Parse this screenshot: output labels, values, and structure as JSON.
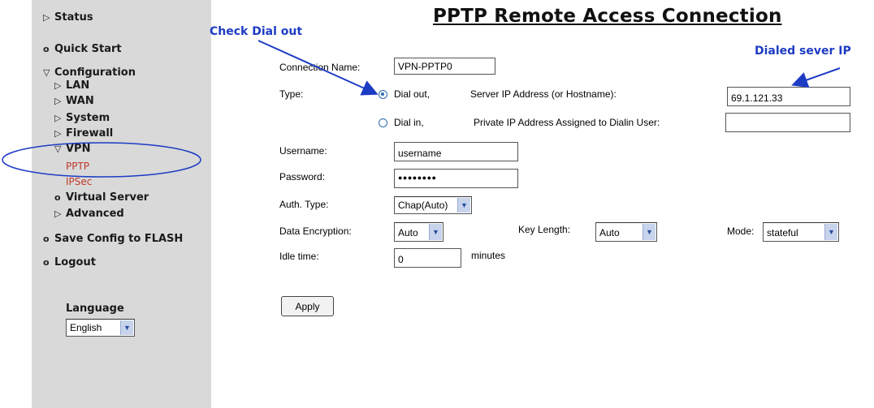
{
  "sidebar": {
    "items": [
      {
        "icon": "arrow-right",
        "label": "Status"
      },
      {
        "icon": "circle",
        "label": "Quick Start"
      },
      {
        "icon": "arrow-down",
        "label": "Configuration"
      },
      {
        "icon": "arrow-right",
        "label": "LAN"
      },
      {
        "icon": "arrow-right",
        "label": "WAN"
      },
      {
        "icon": "arrow-right",
        "label": "System"
      },
      {
        "icon": "arrow-right",
        "label": "Firewall"
      },
      {
        "icon": "arrow-down",
        "label": "VPN"
      },
      {
        "icon": "",
        "label": "PPTP"
      },
      {
        "icon": "",
        "label": "IPSec"
      },
      {
        "icon": "circle",
        "label": "Virtual Server"
      },
      {
        "icon": "arrow-right",
        "label": "Advanced"
      },
      {
        "icon": "circle",
        "label": "Save Config to FLASH"
      },
      {
        "icon": "circle",
        "label": "Logout"
      }
    ],
    "language_label": "Language",
    "language_value": "English",
    "accent_color": "#c0392b"
  },
  "page": {
    "title": "PPTP Remote Access Connection",
    "connection_name_label": "Connection Name:",
    "connection_name_value": "VPN-PPTP0",
    "type_label": "Type:",
    "dial_out_label": "Dial out,",
    "server_ip_label": "Server IP Address (or Hostname):",
    "server_ip_value": "69.1.121.33",
    "dial_in_label": "Dial in,",
    "private_ip_label": "Private IP Address Assigned to Dialin User:",
    "private_ip_value": "",
    "username_label": "Username:",
    "username_value": "username",
    "password_label": "Password:",
    "password_value": "●●●●●●●●",
    "auth_type_label": "Auth. Type:",
    "auth_type_value": "Chap(Auto)",
    "data_encryption_label": "Data Encryption:",
    "data_encryption_value": "Auto",
    "key_length_label": "Key Length:",
    "key_length_value": "Auto",
    "mode_label": "Mode:",
    "mode_value": "stateful",
    "idle_time_label": "Idle time:",
    "idle_time_value": "0",
    "minutes_label": "minutes",
    "apply_label": "Apply",
    "selected_type": "dial_out"
  },
  "annotations": {
    "check_dial_out": "Check Dial out",
    "dialed_server_ip": "Dialed sever IP",
    "color": "#1d3cc4"
  }
}
